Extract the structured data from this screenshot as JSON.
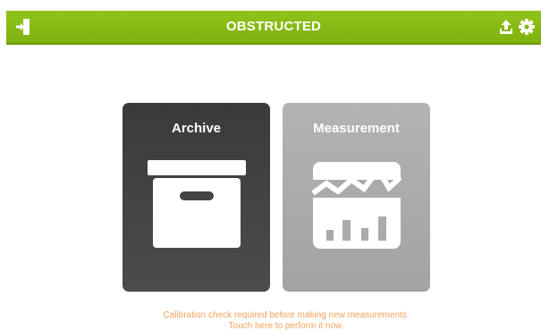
{
  "header": {
    "title": "OBSTRUCTED",
    "exit_icon": "exit-door-icon",
    "upload_icon": "upload-icon",
    "settings_icon": "gear-icon"
  },
  "tiles": [
    {
      "label": "Archive",
      "icon": "archive-box-icon"
    },
    {
      "label": "Measurement",
      "icon": "measurement-chart-icon"
    }
  ],
  "notice": {
    "line1": "Calibration check required before making new measurements.",
    "line2": "Touch here to perform it now."
  },
  "colors": {
    "header_green": "#8cc11c",
    "archive_tile": "#404040",
    "measurement_tile": "#ababab",
    "notice_orange": "#f5a15a"
  }
}
